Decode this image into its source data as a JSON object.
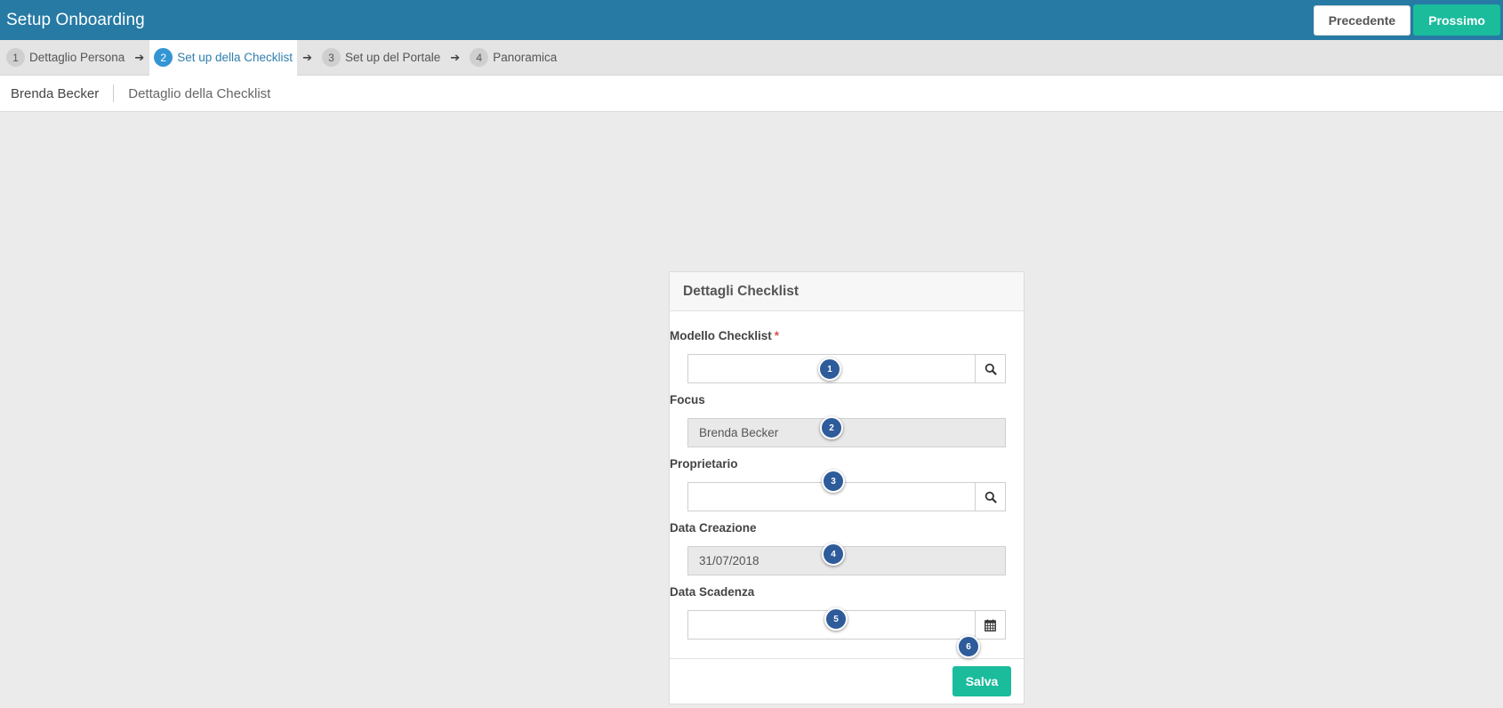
{
  "header": {
    "title": "Setup Onboarding",
    "prev_label": "Precedente",
    "next_label": "Prossimo",
    "bg_color": "#267aa4",
    "accent_color": "#1abc9c"
  },
  "steps": [
    {
      "num": "1",
      "label": "Dettaglio Persona",
      "active": false
    },
    {
      "num": "2",
      "label": "Set up della Checklist",
      "active": true
    },
    {
      "num": "3",
      "label": "Set up del Portale",
      "active": false
    },
    {
      "num": "4",
      "label": "Panoramica",
      "active": false
    }
  ],
  "breadcrumb": {
    "person": "Brenda Becker",
    "page": "Dettaglio della Checklist"
  },
  "card": {
    "title": "Dettagli Checklist",
    "fields": {
      "modello": {
        "label": "Modello Checklist",
        "required_mark": "*",
        "value": "",
        "icon": "search-icon"
      },
      "focus": {
        "label": "Focus",
        "value": "Brenda Becker",
        "readonly": true
      },
      "proprietario": {
        "label": "Proprietario",
        "value": "",
        "icon": "search-icon"
      },
      "data_creazione": {
        "label": "Data Creazione",
        "value": "31/07/2018",
        "readonly": true
      },
      "data_scadenza": {
        "label": "Data Scadenza",
        "value": "",
        "icon": "calendar-icon"
      }
    },
    "save_label": "Salva"
  },
  "markers": [
    "1",
    "2",
    "3",
    "4",
    "5",
    "6"
  ]
}
